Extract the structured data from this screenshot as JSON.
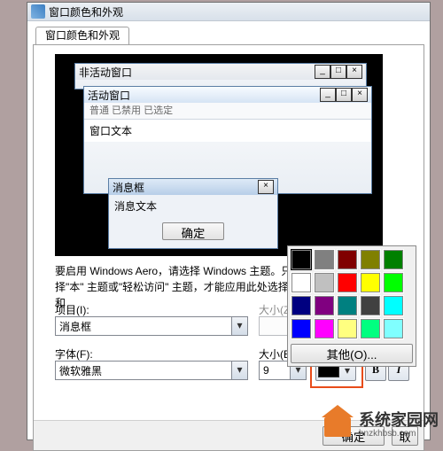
{
  "dialog": {
    "title": "窗口颜色和外观",
    "tab_label": "窗口颜色和外观"
  },
  "preview": {
    "inactive_title": "非活动窗口",
    "active_title": "活动窗口",
    "menu": "普通   已禁用   已选定",
    "window_text": "窗口文本",
    "msgbox_title": "消息框",
    "msgbox_text": "消息文本",
    "msgbox_ok": "确定"
  },
  "hint": "要启用 Windows Aero，请选择 Windows 主题。只有选择\"本\" 主题或\"轻松访问\" 主题，才能应用此处选择的颜色和",
  "labels": {
    "item": "项目(I):",
    "size": "大小(Z):",
    "font": "字体(F):",
    "fsize": "大小(E):"
  },
  "values": {
    "item": "消息框",
    "font": "微软雅黑",
    "fsize": "9"
  },
  "buttons": {
    "bold": "B",
    "italic": "I",
    "ok": "确定",
    "cancel": "取",
    "other": "其他(O)..."
  },
  "palette": {
    "colors": [
      "#000000",
      "#808080",
      "#800000",
      "#808000",
      "#008000",
      "#ffffff",
      "#c0c0c0",
      "#ff0000",
      "#ffff00",
      "#00ff00",
      "#000080",
      "#800080",
      "#008080",
      "#404040",
      "#00ffff",
      "#0000ff",
      "#ff00ff",
      "#ffff80",
      "#00ff80",
      "#80ffff"
    ],
    "selected": 0
  },
  "watermark": {
    "line1": "系统家园网",
    "line2": "hnzkhbsb.com"
  }
}
